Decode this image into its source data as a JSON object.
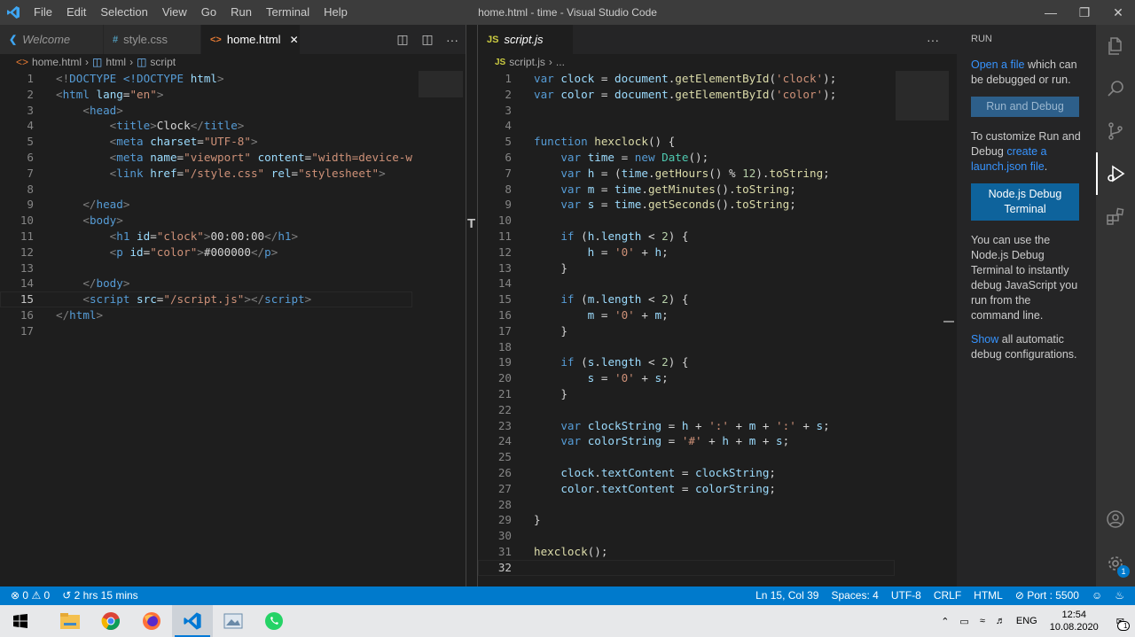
{
  "titlebar": {
    "menu": [
      "File",
      "Edit",
      "Selection",
      "View",
      "Go",
      "Run",
      "Terminal",
      "Help"
    ],
    "title": "home.html - time - Visual Studio Code"
  },
  "left_group": {
    "tabs": [
      {
        "label": "Welcome",
        "icon": "vscode-logo-icon",
        "active": false
      },
      {
        "label": "style.css",
        "icon": "hash-icon",
        "active": false
      },
      {
        "label": "home.html",
        "icon": "html-brackets-icon",
        "active": true
      }
    ],
    "breadcrumb": [
      "home.html",
      "html",
      "script"
    ],
    "lines": [
      [
        [
          "p",
          "<!"
        ],
        [
          "t",
          "DOCTYPE"
        ],
        [
          "w",
          " "
        ],
        [
          "t",
          "<!DOCTYPE"
        ],
        [
          "w",
          " "
        ],
        [
          "a",
          "html"
        ],
        [
          "p",
          ">"
        ]
      ],
      [
        [
          "p",
          "<"
        ],
        [
          "t",
          "html"
        ],
        [
          "w",
          " "
        ],
        [
          "a",
          "lang"
        ],
        [
          "w",
          "="
        ],
        [
          "s",
          "\"en\""
        ],
        [
          "p",
          ">"
        ]
      ],
      [
        [
          "w",
          "    "
        ],
        [
          "p",
          "<"
        ],
        [
          "t",
          "head"
        ],
        [
          "p",
          ">"
        ]
      ],
      [
        [
          "w",
          "        "
        ],
        [
          "p",
          "<"
        ],
        [
          "t",
          "title"
        ],
        [
          "p",
          ">"
        ],
        [
          "w",
          "Clock"
        ],
        [
          "p",
          "</"
        ],
        [
          "t",
          "title"
        ],
        [
          "p",
          ">"
        ]
      ],
      [
        [
          "w",
          "        "
        ],
        [
          "p",
          "<"
        ],
        [
          "t",
          "meta"
        ],
        [
          "w",
          " "
        ],
        [
          "a",
          "charset"
        ],
        [
          "w",
          "="
        ],
        [
          "s",
          "\"UTF-8\""
        ],
        [
          "p",
          ">"
        ]
      ],
      [
        [
          "w",
          "        "
        ],
        [
          "p",
          "<"
        ],
        [
          "t",
          "meta"
        ],
        [
          "w",
          " "
        ],
        [
          "a",
          "name"
        ],
        [
          "w",
          "="
        ],
        [
          "s",
          "\"viewport\""
        ],
        [
          "w",
          " "
        ],
        [
          "a",
          "content"
        ],
        [
          "w",
          "="
        ],
        [
          "s",
          "\"width=device-widt"
        ]
      ],
      [
        [
          "w",
          "        "
        ],
        [
          "p",
          "<"
        ],
        [
          "t",
          "link"
        ],
        [
          "w",
          " "
        ],
        [
          "a",
          "href"
        ],
        [
          "w",
          "="
        ],
        [
          "s",
          "\"/style.css\""
        ],
        [
          "w",
          " "
        ],
        [
          "a",
          "rel"
        ],
        [
          "w",
          "="
        ],
        [
          "s",
          "\"stylesheet\""
        ],
        [
          "p",
          ">"
        ]
      ],
      [],
      [
        [
          "w",
          "    "
        ],
        [
          "p",
          "</"
        ],
        [
          "t",
          "head"
        ],
        [
          "p",
          ">"
        ]
      ],
      [
        [
          "w",
          "    "
        ],
        [
          "p",
          "<"
        ],
        [
          "t",
          "body"
        ],
        [
          "p",
          ">"
        ]
      ],
      [
        [
          "w",
          "        "
        ],
        [
          "p",
          "<"
        ],
        [
          "t",
          "h1"
        ],
        [
          "w",
          " "
        ],
        [
          "a",
          "id"
        ],
        [
          "w",
          "="
        ],
        [
          "s",
          "\"clock\""
        ],
        [
          "p",
          ">"
        ],
        [
          "w",
          "00:00:00"
        ],
        [
          "p",
          "</"
        ],
        [
          "t",
          "h1"
        ],
        [
          "p",
          ">"
        ]
      ],
      [
        [
          "w",
          "        "
        ],
        [
          "p",
          "<"
        ],
        [
          "t",
          "p"
        ],
        [
          "w",
          " "
        ],
        [
          "a",
          "id"
        ],
        [
          "w",
          "="
        ],
        [
          "s",
          "\"color\""
        ],
        [
          "p",
          ">"
        ],
        [
          "w",
          "#000000"
        ],
        [
          "p",
          "</"
        ],
        [
          "t",
          "p"
        ],
        [
          "p",
          ">"
        ]
      ],
      [],
      [
        [
          "w",
          "    "
        ],
        [
          "p",
          "</"
        ],
        [
          "t",
          "body"
        ],
        [
          "p",
          ">"
        ]
      ],
      [
        [
          "w",
          "    "
        ],
        [
          "p",
          "<"
        ],
        [
          "t",
          "script"
        ],
        [
          "w",
          " "
        ],
        [
          "a",
          "src"
        ],
        [
          "w",
          "="
        ],
        [
          "s",
          "\"/script.js\""
        ],
        [
          "p",
          ">"
        ],
        [
          "p",
          "</"
        ],
        [
          "t",
          "script"
        ],
        [
          "p",
          ">"
        ]
      ],
      [
        [
          "p",
          "</"
        ],
        [
          "t",
          "html"
        ],
        [
          "p",
          ">"
        ]
      ],
      []
    ]
  },
  "right_group": {
    "tabs": [
      {
        "label": "script.js",
        "icon": "js-icon",
        "active": true
      }
    ],
    "breadcrumb": [
      "script.js",
      "..."
    ],
    "lines": [
      [
        [
          "k",
          "var"
        ],
        [
          "w",
          " "
        ],
        [
          "v",
          "clock"
        ],
        [
          "w",
          " = "
        ],
        [
          "v",
          "document"
        ],
        [
          "w",
          "."
        ],
        [
          "f",
          "getElementById"
        ],
        [
          "w",
          "("
        ],
        [
          "s",
          "'clock'"
        ],
        [
          "w",
          ");"
        ]
      ],
      [
        [
          "k",
          "var"
        ],
        [
          "w",
          " "
        ],
        [
          "v",
          "color"
        ],
        [
          "w",
          " = "
        ],
        [
          "v",
          "document"
        ],
        [
          "w",
          "."
        ],
        [
          "f",
          "getElementById"
        ],
        [
          "w",
          "("
        ],
        [
          "s",
          "'color'"
        ],
        [
          "w",
          ");"
        ]
      ],
      [],
      [],
      [
        [
          "k",
          "function"
        ],
        [
          "w",
          " "
        ],
        [
          "f",
          "hexclock"
        ],
        [
          "w",
          "() {"
        ]
      ],
      [
        [
          "w",
          "    "
        ],
        [
          "k",
          "var"
        ],
        [
          "w",
          " "
        ],
        [
          "v",
          "time"
        ],
        [
          "w",
          " = "
        ],
        [
          "k",
          "new"
        ],
        [
          "w",
          " "
        ],
        [
          "c",
          "Date"
        ],
        [
          "w",
          "();"
        ]
      ],
      [
        [
          "w",
          "    "
        ],
        [
          "k",
          "var"
        ],
        [
          "w",
          " "
        ],
        [
          "v",
          "h"
        ],
        [
          "w",
          " = ("
        ],
        [
          "v",
          "time"
        ],
        [
          "w",
          "."
        ],
        [
          "f",
          "getHours"
        ],
        [
          "w",
          "() % "
        ],
        [
          "n",
          "12"
        ],
        [
          "w",
          ")."
        ],
        [
          "f",
          "toString"
        ],
        [
          "w",
          ";"
        ]
      ],
      [
        [
          "w",
          "    "
        ],
        [
          "k",
          "var"
        ],
        [
          "w",
          " "
        ],
        [
          "v",
          "m"
        ],
        [
          "w",
          " = "
        ],
        [
          "v",
          "time"
        ],
        [
          "w",
          "."
        ],
        [
          "f",
          "getMinutes"
        ],
        [
          "w",
          "()."
        ],
        [
          "f",
          "toString"
        ],
        [
          "w",
          ";"
        ]
      ],
      [
        [
          "w",
          "    "
        ],
        [
          "k",
          "var"
        ],
        [
          "w",
          " "
        ],
        [
          "v",
          "s"
        ],
        [
          "w",
          " = "
        ],
        [
          "v",
          "time"
        ],
        [
          "w",
          "."
        ],
        [
          "f",
          "getSeconds"
        ],
        [
          "w",
          "()."
        ],
        [
          "f",
          "toString"
        ],
        [
          "w",
          ";"
        ]
      ],
      [],
      [
        [
          "w",
          "    "
        ],
        [
          "k",
          "if"
        ],
        [
          "w",
          " ("
        ],
        [
          "v",
          "h"
        ],
        [
          "w",
          "."
        ],
        [
          "v",
          "length"
        ],
        [
          "w",
          " < "
        ],
        [
          "n",
          "2"
        ],
        [
          "w",
          ") {"
        ]
      ],
      [
        [
          "w",
          "        "
        ],
        [
          "v",
          "h"
        ],
        [
          "w",
          " = "
        ],
        [
          "s",
          "'0'"
        ],
        [
          "w",
          " + "
        ],
        [
          "v",
          "h"
        ],
        [
          "w",
          ";"
        ]
      ],
      [
        [
          "w",
          "    }"
        ]
      ],
      [],
      [
        [
          "w",
          "    "
        ],
        [
          "k",
          "if"
        ],
        [
          "w",
          " ("
        ],
        [
          "v",
          "m"
        ],
        [
          "w",
          "."
        ],
        [
          "v",
          "length"
        ],
        [
          "w",
          " < "
        ],
        [
          "n",
          "2"
        ],
        [
          "w",
          ") {"
        ]
      ],
      [
        [
          "w",
          "        "
        ],
        [
          "v",
          "m"
        ],
        [
          "w",
          " = "
        ],
        [
          "s",
          "'0'"
        ],
        [
          "w",
          " + "
        ],
        [
          "v",
          "m"
        ],
        [
          "w",
          ";"
        ]
      ],
      [
        [
          "w",
          "    }"
        ]
      ],
      [],
      [
        [
          "w",
          "    "
        ],
        [
          "k",
          "if"
        ],
        [
          "w",
          " ("
        ],
        [
          "v",
          "s"
        ],
        [
          "w",
          "."
        ],
        [
          "v",
          "length"
        ],
        [
          "w",
          " < "
        ],
        [
          "n",
          "2"
        ],
        [
          "w",
          ") {"
        ]
      ],
      [
        [
          "w",
          "        "
        ],
        [
          "v",
          "s"
        ],
        [
          "w",
          " = "
        ],
        [
          "s",
          "'0'"
        ],
        [
          "w",
          " + "
        ],
        [
          "v",
          "s"
        ],
        [
          "w",
          ";"
        ]
      ],
      [
        [
          "w",
          "    }"
        ]
      ],
      [],
      [
        [
          "w",
          "    "
        ],
        [
          "k",
          "var"
        ],
        [
          "w",
          " "
        ],
        [
          "v",
          "clockString"
        ],
        [
          "w",
          " = "
        ],
        [
          "v",
          "h"
        ],
        [
          "w",
          " + "
        ],
        [
          "s",
          "':'"
        ],
        [
          "w",
          " + "
        ],
        [
          "v",
          "m"
        ],
        [
          "w",
          " + "
        ],
        [
          "s",
          "':'"
        ],
        [
          "w",
          " + "
        ],
        [
          "v",
          "s"
        ],
        [
          "w",
          ";"
        ]
      ],
      [
        [
          "w",
          "    "
        ],
        [
          "k",
          "var"
        ],
        [
          "w",
          " "
        ],
        [
          "v",
          "colorString"
        ],
        [
          "w",
          " = "
        ],
        [
          "s",
          "'#'"
        ],
        [
          "w",
          " + "
        ],
        [
          "v",
          "h"
        ],
        [
          "w",
          " + "
        ],
        [
          "v",
          "m"
        ],
        [
          "w",
          " + "
        ],
        [
          "v",
          "s"
        ],
        [
          "w",
          ";"
        ]
      ],
      [],
      [
        [
          "w",
          "    "
        ],
        [
          "v",
          "clock"
        ],
        [
          "w",
          "."
        ],
        [
          "v",
          "textContent"
        ],
        [
          "w",
          " = "
        ],
        [
          "v",
          "clockString"
        ],
        [
          "w",
          ";"
        ]
      ],
      [
        [
          "w",
          "    "
        ],
        [
          "v",
          "color"
        ],
        [
          "w",
          "."
        ],
        [
          "v",
          "textContent"
        ],
        [
          "w",
          " = "
        ],
        [
          "v",
          "colorString"
        ],
        [
          "w",
          ";"
        ]
      ],
      [],
      [
        [
          "w",
          "}"
        ]
      ],
      [],
      [
        [
          "f",
          "hexclock"
        ],
        [
          "w",
          "();"
        ]
      ],
      []
    ]
  },
  "sidebar": {
    "header": "RUN",
    "open_file_link": "Open a file",
    "open_file_rest": " which can be debugged or run.",
    "run_debug_button": "Run and Debug",
    "customize_text": "To customize Run and Debug ",
    "create_link": "create a launch.json file",
    "customize_end": ".",
    "nodejs_button": "Node.js Debug Terminal",
    "nodejs_desc": "You can use the Node.js Debug Terminal to instantly debug JavaScript you run from the command line.",
    "show_link": "Show",
    "show_rest": " all automatic debug configurations."
  },
  "statusbar": {
    "errors": "0",
    "warnings": "0",
    "time_spent": "2 hrs 15 mins",
    "position": "Ln 15, Col 39",
    "spaces": "Spaces: 4",
    "encoding": "UTF-8",
    "eol": "CRLF",
    "language": "HTML",
    "port": "Port : 5500"
  },
  "taskbar": {
    "lang": "ENG",
    "time": "12:54",
    "date": "10.08.2020",
    "notif_count": "1"
  },
  "activity_badge": "1"
}
